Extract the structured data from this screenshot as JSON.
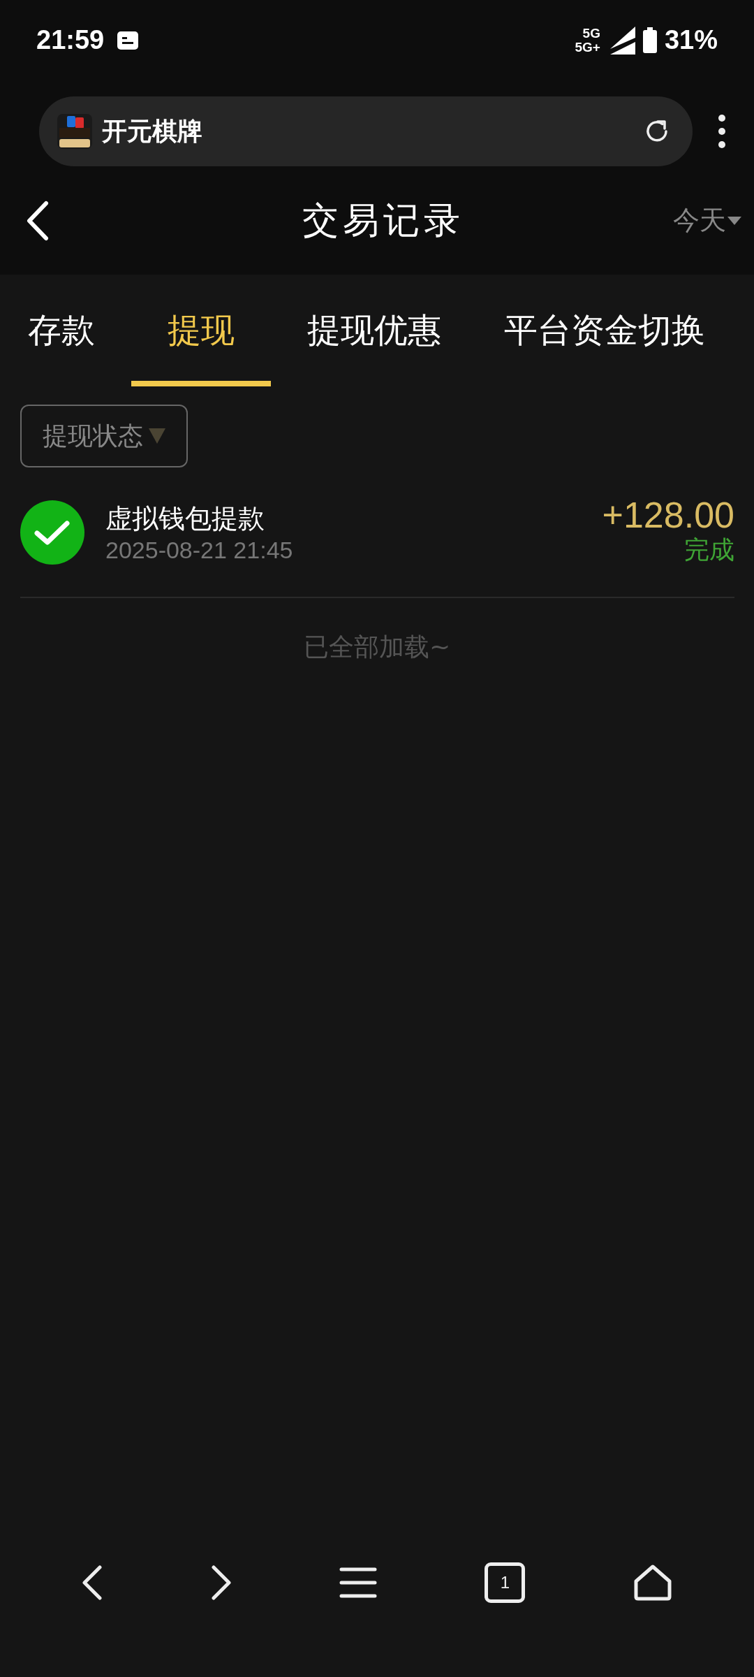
{
  "status_bar": {
    "time": "21:59",
    "network_top": "5G",
    "network_bottom": "5G+",
    "battery": "31%"
  },
  "address_bar": {
    "site_name": "开元棋牌"
  },
  "header": {
    "title": "交易记录",
    "date_filter": "今天"
  },
  "tabs": [
    {
      "label": "存款",
      "selected": false
    },
    {
      "label": "提现",
      "selected": true
    },
    {
      "label": "提现优惠",
      "selected": false
    },
    {
      "label": "平台资金切换",
      "selected": false
    }
  ],
  "status_filter": {
    "label": "提现状态"
  },
  "records": [
    {
      "title": "虚拟钱包提款",
      "time": "2025-08-21 21:45",
      "amount": "+128.00",
      "status": "完成",
      "kind": "completed"
    }
  ],
  "footer_note": "已全部加载~",
  "bottom_nav": {
    "tab_count": "1"
  }
}
